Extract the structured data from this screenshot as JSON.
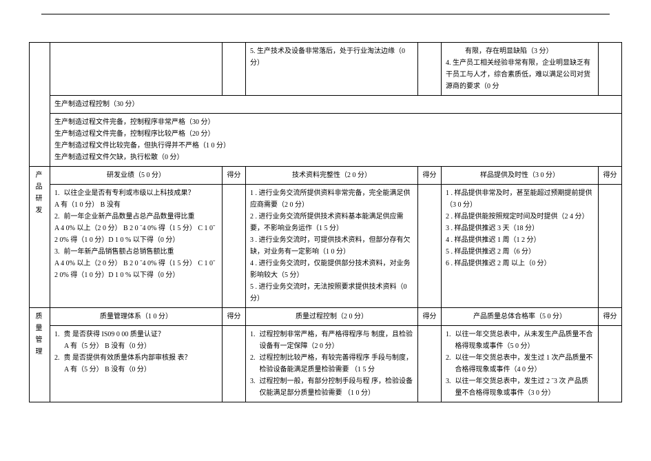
{
  "top_row": {
    "left_tail_item": "5.    生产技术及设备非常落后，处于行业淘汰边缘（0 分）",
    "right_tail": {
      "line1": "有限，存在明显缺陷（3 分）",
      "item4": "4.    生产员工相关经验非常有限，企业明显缺乏有干员工与人才，综合素质低，难以满足公司对货源商的要求（0 分"
    }
  },
  "proc_control": {
    "header": "生产制造过程控制（30 分）",
    "lines": [
      "生产制造过程文件完备，控制程序非常严格（30 分）",
      "生产制造过程文件完备，控制程序比较严格（20 分）",
      "生产制造过程文件比较完备，但执行得并不严格（1 0 分）",
      "生产制造过程文件欠缺，执行松散（0 分）"
    ]
  },
  "rnd_section": {
    "vcat": "产品研发",
    "col1_header": "研发业绩（5 0 分）",
    "col1_body": {
      "q1_num": "1.",
      "q1": "以往企业是否有专利或市级以上科技成果？",
      "q1_opts": "A 有（1 0 分）   B 没有",
      "q2_num": "2.",
      "q2": "前一年企业新产品数量占总产品数量得比重",
      "q2_opts": "A 4 0% 以上（2 0 分）  B 2 0 ˜4 0% 得（1 5 分）    C 1 0˜2 0% 得（1 0 分）D 1 0 % 以下得（0 分）",
      "q3_num": "3.",
      "q3": "前一年新产品销售额占总销售额比重",
      "q3_opts": "A 4 0% 以上（2 0 分）  B 2 0 ˜4 0% 得（1 5 分）    C 1 0˜2 0% 得（1 0 分）D 1 0 % 以下得（0 分）"
    },
    "score_label": "得分",
    "col2_header": "技术资料完整性（2 0 分）",
    "col2_body": [
      "1 . 进行业务交流所提供资料非常完备，完全能满足供应商需要（2 0 分）",
      "2 . 进行业务交流所提供技术资料基本能满足供应需要，不影响业务运作（1 5 分）",
      "3 . 进行业务交流时，可提供技术资料，但部分存有欠缺，对业务有一定影响（1 0 分）",
      "4 . 进行业务交流时，仅能提供部分技术资料，对业务影响较大（5 分）",
      "5 . 进行业务交流时，无法按照要求提供技术资料（0 分）"
    ],
    "col3_header": "样品提供及时性（3 0 分）",
    "col3_body": [
      "1 . 样品提供非常及时，甚至能超过预期提前提供（3 0 分）",
      "2 . 样品提供能按照规定时间及时提供（2 4 分）",
      "3 . 样品提供推迟 3 天（18 分）",
      "4 . 样品提供推迟 1 周（1 2 分）",
      "5 . 样品提供推迟 2 周（6 分）",
      "6 . 样品提供推迟 2 周 以上（0 分）"
    ]
  },
  "qc_section": {
    "vcat": "质量管理",
    "col1_header": "质量管理体系（1 0 分）",
    "col1_body": {
      "q1_num": "1.",
      "q1": "贵 是否获得 IS09 0 00 质量认证？",
      "q1_opts": "A 有（5 分）   B 没有（0 分）",
      "q2_num": "2.",
      "q2": "贵 是否提供有效质量体系内部审核报  表？",
      "q2_opts": "A 有（5 分）    B 没有（0 分）"
    },
    "score_label": "得分",
    "col2_header": "质量过程控制（2 0 分）",
    "col2_body": [
      "过程控制非常严格，有严格得程序与    制度，且检验设备有一定保障（2 0 分）",
      "过程控制比较严格，有较完善得程序    手段与制度，检验设备能满足质量检验需要  （1 5 分",
      "过程控制一般，有部分控制手段与程  序，检验设备仅能满足部分质量检验需要  （1 0 分）"
    ],
    "col2_nums": [
      "1.",
      "2.",
      "3."
    ],
    "col3_header": "产品质量总体合格率（5 0 分）",
    "col3_body": [
      "以往一年交货总表中，从未发生产品质量不合格得现象或事件（5 0 分）",
      "以往一年交货总表中，发生过  1 次产品质量不合格得现象或事件（4 0 分）",
      "以往一年交货总表中，发生过  2 ˜3 次   产品质量不合格得现象或事件（3 0 分）"
    ],
    "col3_nums": [
      "1.",
      "2.",
      "3."
    ]
  }
}
